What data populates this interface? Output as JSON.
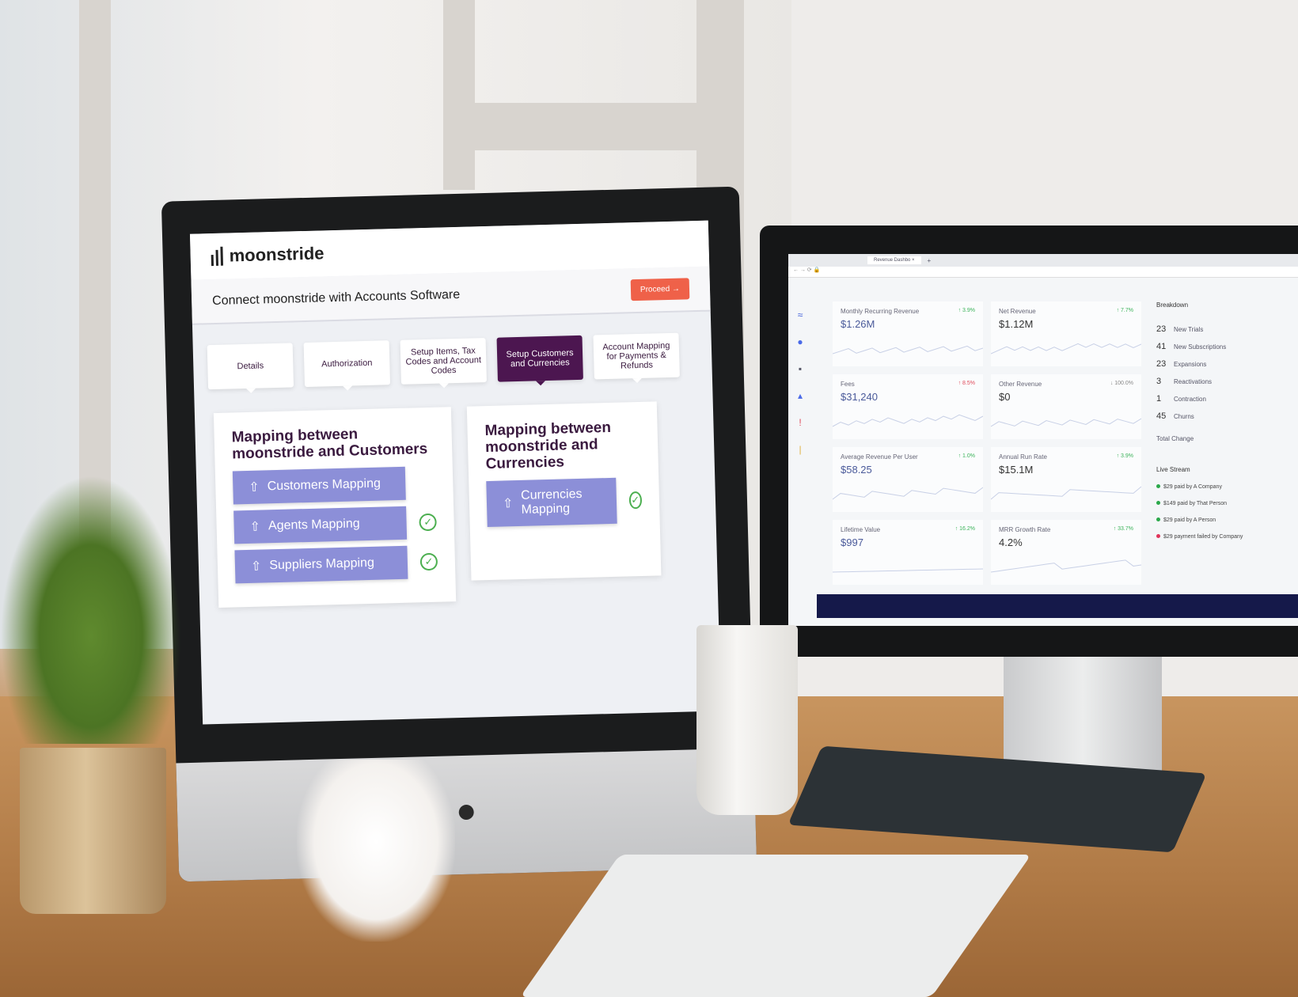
{
  "left_app": {
    "brand": "moonstride",
    "page_title": "Connect moonstride with Accounts Software",
    "proceed_label": "Proceed →",
    "tabs": [
      {
        "label": "Details",
        "active": false
      },
      {
        "label": "Authorization",
        "active": false
      },
      {
        "label": "Setup Items, Tax Codes and Account Codes",
        "active": false
      },
      {
        "label": "Setup Customers and Currencies",
        "active": true
      },
      {
        "label": "Account Mapping for Payments & Refunds",
        "active": false
      }
    ],
    "customers_card": {
      "title": "Mapping between moonstride and Customers",
      "buttons": [
        {
          "label": "Customers Mapping",
          "done": false
        },
        {
          "label": "Agents Mapping",
          "done": true
        },
        {
          "label": "Suppliers Mapping",
          "done": true
        }
      ]
    },
    "currencies_card": {
      "title": "Mapping between moonstride and Currencies",
      "buttons": [
        {
          "label": "Currencies Mapping",
          "done": true
        }
      ]
    },
    "colors": {
      "accent": "#4c1650",
      "button": "#8c8fd8",
      "proceed": "#ef6149",
      "check": "#4caf50"
    }
  },
  "right_app": {
    "browser_tab": "Revenue Dashbo",
    "metrics": [
      {
        "label": "Monthly Recurring Revenue",
        "value": "$1.26M",
        "change": "↑ 3.9%",
        "trend": "up"
      },
      {
        "label": "Net Revenue",
        "value": "$1.12M",
        "change": "↑ 7.7%",
        "trend": "up"
      },
      {
        "label": "Fees",
        "value": "$31,240",
        "change": "↑ 8.5%",
        "trend": "bad"
      },
      {
        "label": "Other Revenue",
        "value": "$0",
        "change": "↓ 100.0%",
        "trend": "neutral"
      },
      {
        "label": "Average Revenue Per User",
        "value": "$58.25",
        "change": "↑ 1.0%",
        "trend": "up"
      },
      {
        "label": "Annual Run Rate",
        "value": "$15.1M",
        "change": "↑ 3.9%",
        "trend": "up"
      },
      {
        "label": "Lifetime Value",
        "value": "$997",
        "change": "↑ 16.2%",
        "trend": "up"
      },
      {
        "label": "MRR Growth Rate",
        "value": "4.2%",
        "change": "↑ 33.7%",
        "trend": "up"
      }
    ],
    "breakdown": {
      "title": "Breakdown",
      "rows": [
        {
          "count": "23",
          "label": "New Trials"
        },
        {
          "count": "41",
          "label": "New Subscriptions"
        },
        {
          "count": "23",
          "label": "Expansions"
        },
        {
          "count": "3",
          "label": "Reactivations"
        },
        {
          "count": "1",
          "label": "Contraction"
        },
        {
          "count": "45",
          "label": "Churns"
        }
      ],
      "total_label": "Total Change"
    },
    "live_stream": {
      "title": "Live Stream",
      "events": [
        {
          "text": "$29 paid by A Company",
          "status": "ok"
        },
        {
          "text": "$149 paid by That Person",
          "status": "ok"
        },
        {
          "text": "$29 paid by A Person",
          "status": "ok"
        },
        {
          "text": "$29 payment failed by Company",
          "status": "failed"
        }
      ]
    }
  }
}
